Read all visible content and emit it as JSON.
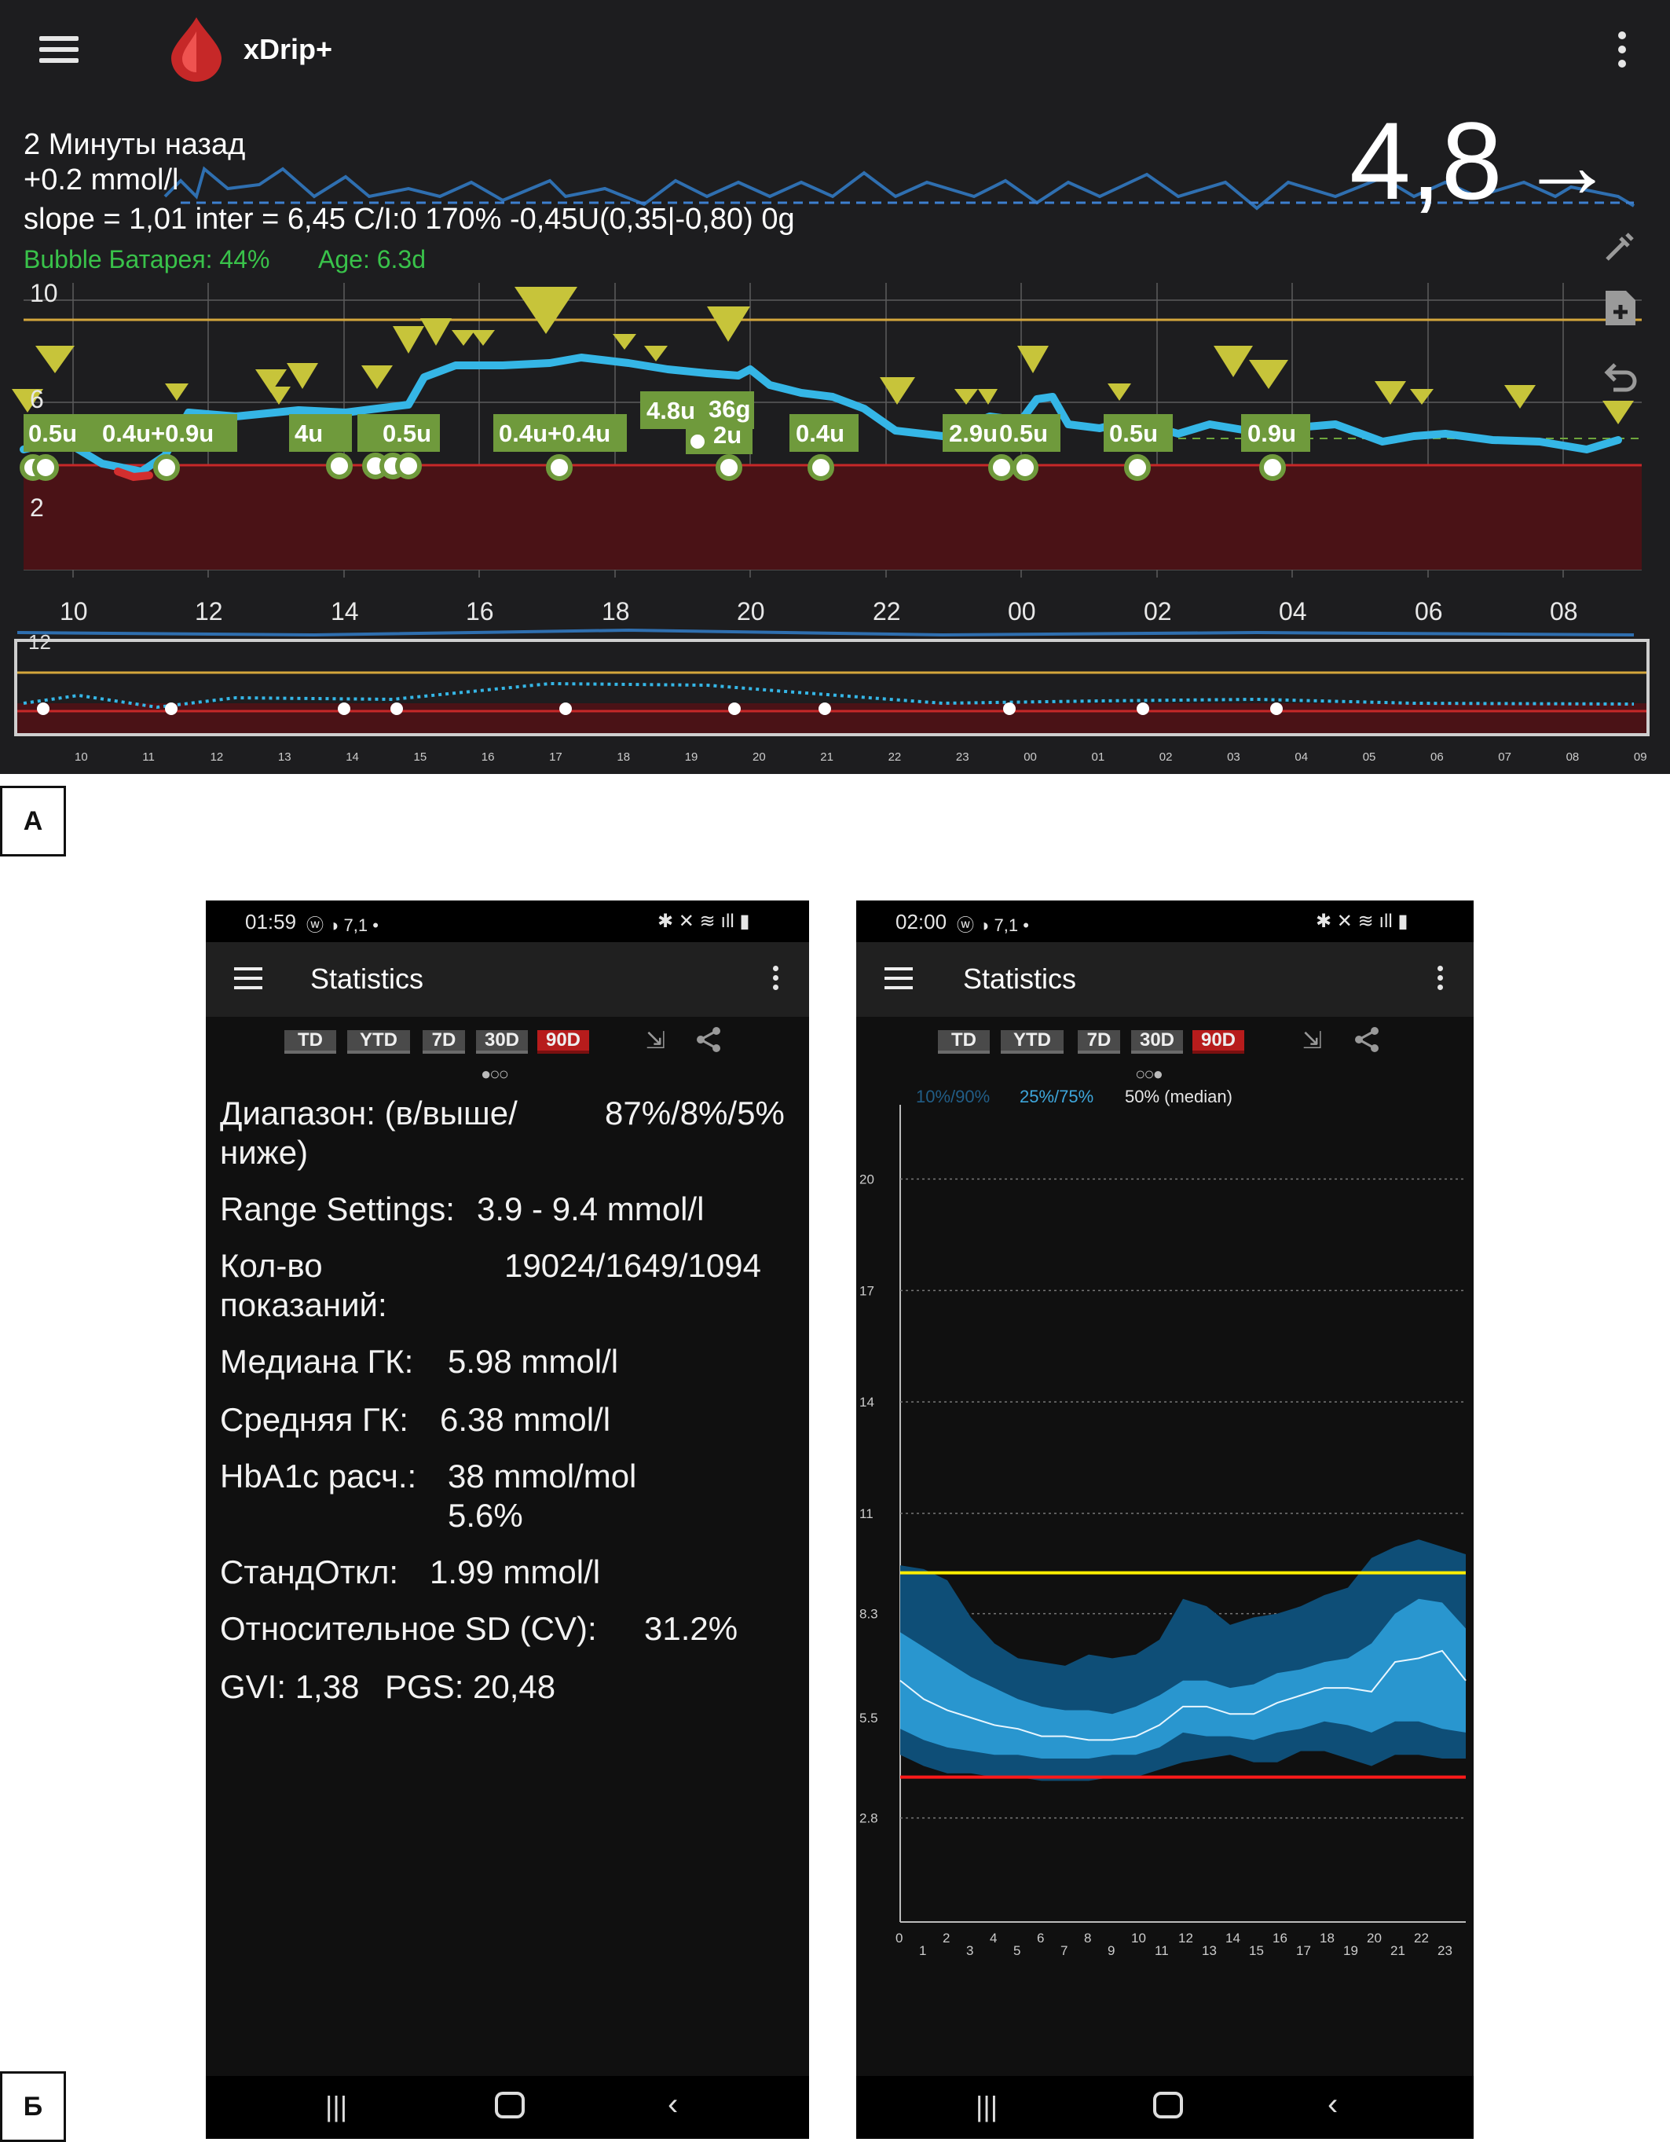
{
  "panel_a": {
    "app_title": "xDrip+",
    "status_line1": "2 Минуты назад",
    "status_line2": "+0.2 mmol/l",
    "status_line3": "slope = 1,01 inter = 6,45 C/I:0  170% -0,45U(0,35|-0,80) 0g",
    "battery": "Bubble Батарея: 44%",
    "age": "Age: 6.3d",
    "current_value": "4,8",
    "trend_arrow": "→",
    "y_ticks": [
      "10",
      "6",
      "2"
    ],
    "x_ticks": [
      "10",
      "12",
      "14",
      "16",
      "18",
      "20",
      "22",
      "00",
      "02",
      "04",
      "06",
      "08"
    ],
    "mini_y_tick": "12",
    "mini_x_ticks": [
      "10",
      "11",
      "12",
      "13",
      "14",
      "15",
      "16",
      "17",
      "18",
      "19",
      "20",
      "21",
      "22",
      "23",
      "00",
      "01",
      "02",
      "03",
      "04",
      "05",
      "06",
      "07",
      "08",
      "09"
    ],
    "treatments": [
      "0.5u",
      "0.4u+0.9u",
      "4u",
      "0.5u",
      "0.4u+0.4u",
      "4.8u",
      "36g",
      "2u",
      "0.4u",
      "2.9u",
      "0.5u",
      "0.5u",
      "0.9u"
    ],
    "colors": {
      "glucose": "#35b6e6",
      "high_line": "#d4a63c",
      "low_zone": "#4a1216",
      "treatment_label": "#6f9a3c",
      "marker": "#c7c43a"
    },
    "label": "A"
  },
  "panel_b": {
    "label": "Б",
    "phone1": {
      "time": "01:59",
      "status_icons": "ⓦ ◑ 7,1 •",
      "title": "Statistics",
      "tabs": [
        "TD",
        "YTD",
        "7D",
        "30D",
        "90D"
      ],
      "active_tab": "90D",
      "page_indicator": "●○○",
      "stats": [
        {
          "label": "Диапазон: (в/выше/\nниже)",
          "value": "87%/8%/5%"
        },
        {
          "label": "Range Settings:",
          "value": "3.9 - 9.4 mmol/l"
        },
        {
          "label": "Кол-во\nпоказаний:",
          "value": "19024/1649/1094"
        },
        {
          "label": "Медиана ГК:",
          "value": "5.98 mmol/l"
        },
        {
          "label": "Средняя ГК:",
          "value": "6.38 mmol/l"
        },
        {
          "label": "HbA1c расч.:",
          "value": "38 mmol/mol\n5.6%"
        },
        {
          "label": "СтандОткл:",
          "value": "1.99 mmol/l"
        },
        {
          "label": "Относительное SD (CV):",
          "value": "31.2%"
        },
        {
          "label": "GVI: 1,38",
          "value": "PGS:  20,48"
        }
      ]
    },
    "phone2": {
      "time": "02:00",
      "status_icons": "ⓦ ◑ 7,1 •",
      "title": "Statistics",
      "tabs": [
        "TD",
        "YTD",
        "7D",
        "30D",
        "90D"
      ],
      "active_tab": "90D",
      "page_indicator": "○○●",
      "legend": [
        "10%/90%",
        "25%/75%",
        "50% (median)"
      ],
      "chart_data": {
        "type": "area",
        "title": "",
        "xlabel": "",
        "ylabel": "",
        "y_ticks": [
          20,
          17,
          14,
          11,
          8.3,
          5.5,
          2.8
        ],
        "x_ticks": [
          "0",
          "1",
          "2",
          "3",
          "4",
          "5",
          "6",
          "7",
          "8",
          "9",
          "10",
          "11",
          "12",
          "13",
          "14",
          "15",
          "16",
          "17",
          "18",
          "19",
          "20",
          "21",
          "22",
          "23"
        ],
        "ylim": [
          0,
          22
        ],
        "xlim": [
          0,
          24
        ],
        "high_line": 9.4,
        "low_line": 3.9,
        "hours": [
          0,
          1,
          2,
          3,
          4,
          5,
          6,
          7,
          8,
          9,
          10,
          11,
          12,
          13,
          14,
          15,
          16,
          17,
          18,
          19,
          20,
          21,
          22,
          23,
          24
        ],
        "series": [
          {
            "name": "10%/90%",
            "lower": [
              4.5,
              4.2,
              4.0,
              4.0,
              3.9,
              3.9,
              3.8,
              3.8,
              3.8,
              3.9,
              3.9,
              4.1,
              4.3,
              4.4,
              4.5,
              4.3,
              4.3,
              4.6,
              4.6,
              4.4,
              4.2,
              4.5,
              4.5,
              4.4,
              4.4
            ],
            "upper": [
              9.6,
              9.5,
              9.2,
              8.2,
              7.5,
              7.1,
              7.0,
              6.9,
              7.2,
              7.1,
              7.2,
              7.6,
              8.7,
              8.5,
              8.0,
              8.2,
              8.3,
              8.5,
              8.8,
              9.0,
              9.8,
              10.1,
              10.3,
              10.1,
              9.9
            ]
          },
          {
            "name": "25%/75%",
            "lower": [
              5.2,
              4.9,
              4.7,
              4.6,
              4.5,
              4.5,
              4.4,
              4.4,
              4.4,
              4.5,
              4.5,
              4.7,
              5.1,
              5.0,
              5.0,
              4.9,
              5.1,
              5.2,
              5.4,
              5.3,
              5.1,
              5.4,
              5.4,
              5.2,
              5.1
            ],
            "upper": [
              7.8,
              7.4,
              7.0,
              6.6,
              6.3,
              6.0,
              5.8,
              5.7,
              5.7,
              5.6,
              5.8,
              6.1,
              6.5,
              6.5,
              6.3,
              6.4,
              6.7,
              6.8,
              7.0,
              7.1,
              7.5,
              8.3,
              8.7,
              8.6,
              7.9
            ]
          },
          {
            "name": "50% (median)",
            "values": [
              6.5,
              6.0,
              5.7,
              5.5,
              5.3,
              5.2,
              5.0,
              5.0,
              4.9,
              4.9,
              5.0,
              5.3,
              5.8,
              5.8,
              5.6,
              5.6,
              5.9,
              6.1,
              6.3,
              6.3,
              6.2,
              7.0,
              7.1,
              7.3,
              6.5
            ]
          }
        ]
      }
    }
  }
}
